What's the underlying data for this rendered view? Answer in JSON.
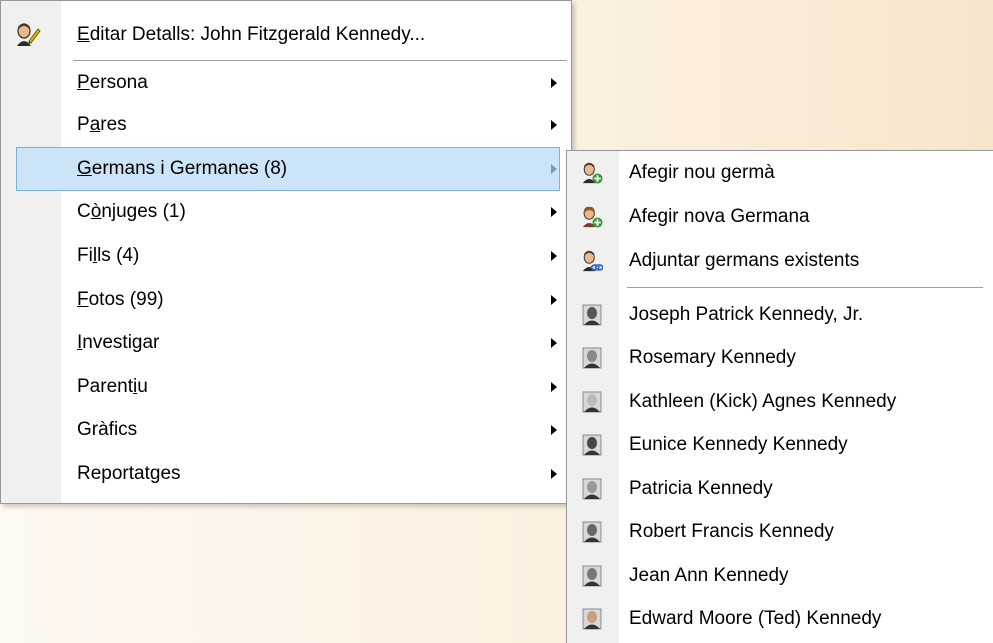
{
  "main_menu": {
    "edit_label": "Editar Detalls: John Fitzgerald Kennedy...",
    "edit_icon": "person-pencil-icon",
    "items": [
      {
        "label": "Persona",
        "selected": false
      },
      {
        "label": "Pares",
        "selected": false
      },
      {
        "label": "Germans i Germanes (8)",
        "selected": true
      },
      {
        "label": "Cònjuges (1)",
        "selected": false
      },
      {
        "label": "Fills (4)",
        "selected": false
      },
      {
        "label": "Fotos (99)",
        "selected": false
      },
      {
        "label": "Investigar",
        "selected": false
      },
      {
        "label": "Parentiu",
        "selected": false
      },
      {
        "label": "Gràfics",
        "selected": false
      },
      {
        "label": "Reportatges",
        "selected": false
      }
    ]
  },
  "submenu": {
    "actions": [
      {
        "label": "Afegir nou germà",
        "icon": "add-brother-icon"
      },
      {
        "label": "Afegir nova Germana",
        "icon": "add-sister-icon"
      },
      {
        "label": "Adjuntar germans existents",
        "icon": "attach-siblings-icon"
      }
    ],
    "siblings": [
      {
        "label": "Joseph Patrick Kennedy, Jr.",
        "icon": "portrait-icon"
      },
      {
        "label": "Rosemary Kennedy",
        "icon": "portrait-icon"
      },
      {
        "label": "Kathleen (Kick) Agnes Kennedy",
        "icon": "portrait-icon"
      },
      {
        "label": "Eunice Kennedy Kennedy",
        "icon": "portrait-icon"
      },
      {
        "label": "Patricia Kennedy",
        "icon": "portrait-icon"
      },
      {
        "label": "Robert Francis Kennedy",
        "icon": "portrait-icon"
      },
      {
        "label": "Jean Ann Kennedy",
        "icon": "portrait-icon"
      },
      {
        "label": "Edward Moore (Ted) Kennedy",
        "icon": "portrait-icon"
      }
    ]
  },
  "colors": {
    "selection": "#cce4f7",
    "selection_border": "#7ab3e0",
    "add_badge": "#3a9a3a",
    "link_badge": "#3b66c4"
  }
}
